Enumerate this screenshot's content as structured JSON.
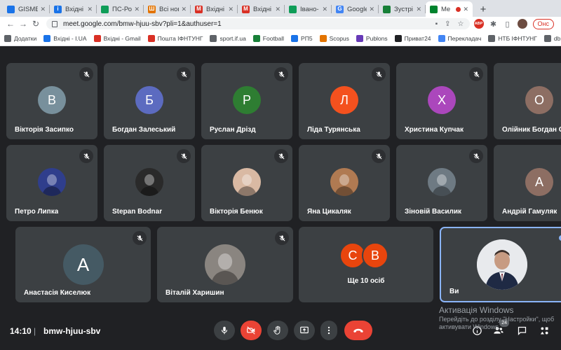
{
  "browser": {
    "tabs": [
      {
        "label": "GISME",
        "favicon_letter": "",
        "favicon_color": "#1a73e8",
        "active": false
      },
      {
        "label": "Вхідні",
        "favicon_letter": "i",
        "favicon_color": "#1a73e8",
        "active": false
      },
      {
        "label": "ПС-Роз",
        "favicon_letter": "",
        "favicon_color": "#0f9d58",
        "active": false
      },
      {
        "label": "Всі нов",
        "favicon_letter": "Ш",
        "favicon_color": "#e37400",
        "active": false
      },
      {
        "label": "Вхідні",
        "favicon_letter": "M",
        "favicon_color": "#d93025",
        "active": false
      },
      {
        "label": "Вхідні",
        "favicon_letter": "M",
        "favicon_color": "#d93025",
        "active": false
      },
      {
        "label": "Івано-",
        "favicon_letter": "",
        "favicon_color": "#0f9d58",
        "active": false
      },
      {
        "label": "Google",
        "favicon_letter": "G",
        "favicon_color": "#4285f4",
        "active": false
      },
      {
        "label": "Зустрі",
        "favicon_letter": "",
        "favicon_color": "#188038",
        "active": false
      },
      {
        "label": "Me",
        "favicon_letter": "",
        "favicon_color": "#00832d",
        "active": true
      }
    ],
    "new_tab": "+",
    "url": "meet.google.com/bmw-hjuu-sbv?pli=1&authuser=1",
    "profile_button": "Онс",
    "bookmarks": [
      {
        "label": "Додатки",
        "icon_color": "#5f6368"
      },
      {
        "label": "Вхідні - I.UA",
        "icon_color": "#1a73e8"
      },
      {
        "label": "Вхідні - Gmail",
        "icon_color": "#d93025"
      },
      {
        "label": "Пошта ІФНТУНГ",
        "icon_color": "#d93025"
      },
      {
        "label": "sport.if.ua",
        "icon_color": "#5f6368"
      },
      {
        "label": "Football",
        "icon_color": "#188038"
      },
      {
        "label": "РП5",
        "icon_color": "#1a73e8"
      },
      {
        "label": "Scopus",
        "icon_color": "#e37400"
      },
      {
        "label": "Publons",
        "icon_color": "#673ab7"
      },
      {
        "label": "Приват24",
        "icon_color": "#202124"
      },
      {
        "label": "Перекладач",
        "icon_color": "#4285f4"
      },
      {
        "label": "НТБ ІФНТУНГ",
        "icon_color": "#5f6368"
      },
      {
        "label": "db.uaf.ua",
        "icon_color": "#5f6368"
      }
    ]
  },
  "participants": [
    {
      "name": "Вікторія Засипко",
      "initial": "В",
      "color": "#78909c",
      "type": "letter"
    },
    {
      "name": "Богдан Залеський",
      "initial": "Б",
      "color": "#5c6bc0",
      "type": "letter"
    },
    {
      "name": "Руслан Дрізд",
      "initial": "Р",
      "color": "#2e7d32",
      "type": "letter"
    },
    {
      "name": "Ліда Турянська",
      "initial": "Л",
      "color": "#f4511e",
      "type": "letter"
    },
    {
      "name": "Христина Купчак",
      "initial": "Х",
      "color": "#ab47bc",
      "type": "letter"
    },
    {
      "name": "Олійник Богдан С",
      "initial": "О",
      "color": "#8d6e63",
      "type": "letter"
    },
    {
      "name": "Петро Липка",
      "initial": "",
      "color": "#2f3e8c",
      "type": "photo"
    },
    {
      "name": "Stepan Bodnar",
      "initial": "",
      "color": "#2a2a2a",
      "type": "photo"
    },
    {
      "name": "Вікторія Бенюк",
      "initial": "",
      "color": "#d9b9a3",
      "type": "photo"
    },
    {
      "name": "Яна Цикаляк",
      "initial": "",
      "color": "#b07a52",
      "type": "photo"
    },
    {
      "name": "Зіновій Василик",
      "initial": "",
      "color": "#6e7a83",
      "type": "photo"
    },
    {
      "name": "Андрій Гамуляк",
      "initial": "А",
      "color": "#8d6e63",
      "type": "letter"
    },
    {
      "name": "Анастасія Киселюк",
      "initial": "А",
      "color": "#455a64",
      "type": "letter"
    },
    {
      "name": "Віталій Харишин",
      "initial": "",
      "color": "#8a8580",
      "type": "photo"
    }
  ],
  "more": {
    "label": "Ще 10 осіб",
    "initials": [
      "С",
      "В"
    ]
  },
  "self": {
    "name": "Ви"
  },
  "meeting": {
    "time": "14:10",
    "separator": "|",
    "code": "bmw-hjuu-sbv"
  },
  "controls": {
    "mic": "microphone-icon",
    "camera": "camera-off-icon",
    "hand": "raise-hand-icon",
    "present": "present-icon",
    "more": "more-options-icon",
    "leave": "leave-call-icon"
  },
  "people_count": "24",
  "watermark": {
    "title": "Активація Windows",
    "line1": "Перейдіть до розділу \"Настройки\", щоб",
    "line2": "активувати Windows."
  },
  "colors": {
    "meet_bg": "#202124",
    "tile_bg": "#3c4043",
    "accent": "#8ab4f8",
    "danger": "#ea4335"
  }
}
